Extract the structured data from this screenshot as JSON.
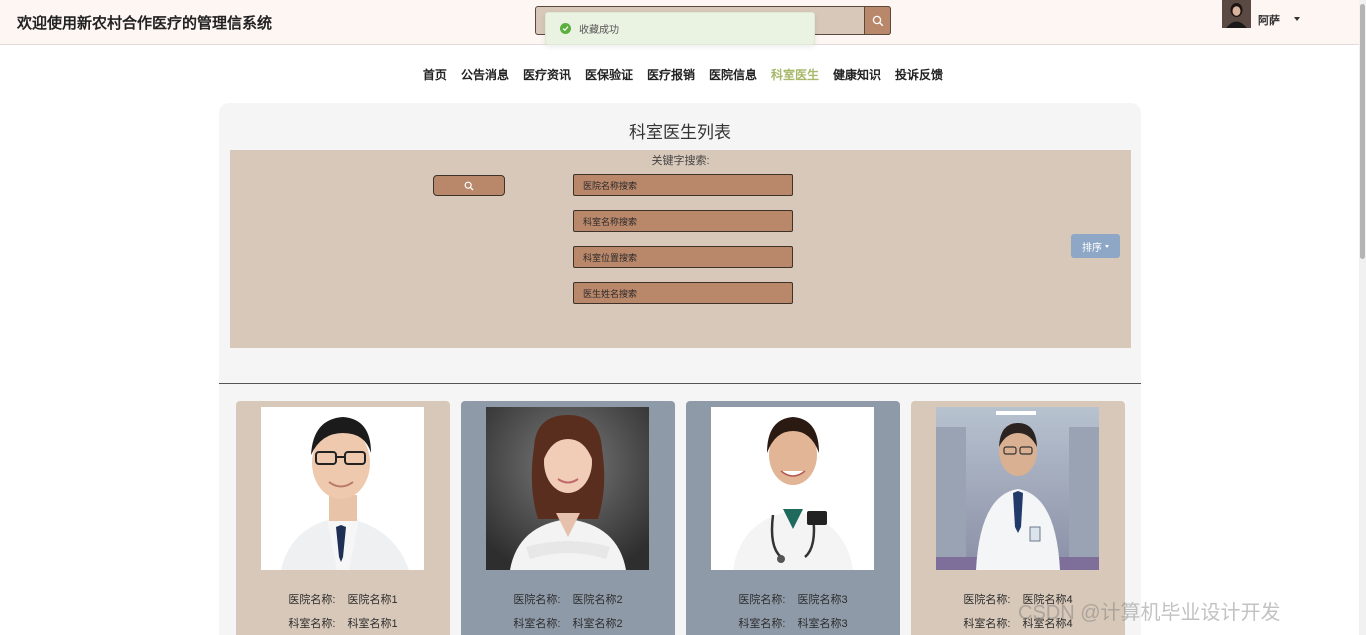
{
  "header": {
    "title": "欢迎使用新农村合作医疗的管理信系统",
    "search_icon": "search-icon",
    "user_name": "阿萨"
  },
  "toast": {
    "message": "收藏成功",
    "icon": "check-circle-icon"
  },
  "nav": {
    "items": [
      "首页",
      "公告消息",
      "医疗资讯",
      "医保验证",
      "医疗报销",
      "医院信息",
      "科室医生",
      "健康知识",
      "投诉反馈"
    ],
    "active": "科室医生"
  },
  "panel": {
    "title": "科室医生列表",
    "keyword_label": "关键字搜索:",
    "search_placeholders": {
      "hospital": "医院名称搜索",
      "department": "科室名称搜索",
      "location": "科室位置搜索",
      "doctor": "医生姓名搜索"
    },
    "sort_label": "排序"
  },
  "doctors": [
    {
      "hospital_label": "医院名称:",
      "hospital": "医院名称1",
      "department_label": "科室名称:",
      "department": "科室名称1"
    },
    {
      "hospital_label": "医院名称:",
      "hospital": "医院名称2",
      "department_label": "科室名称:",
      "department": "科室名称2"
    },
    {
      "hospital_label": "医院名称:",
      "hospital": "医院名称3",
      "department_label": "科室名称:",
      "department": "科室名称3"
    },
    {
      "hospital_label": "医院名称:",
      "hospital": "医院名称4",
      "department_label": "科室名称:",
      "department": "科室名称4"
    }
  ],
  "watermark": "CSDN @计算机毕业设计开发",
  "colors": {
    "accent_active": "#a6b86a",
    "filter_bg": "#d7c8b9",
    "input_bg": "#b9876a",
    "sort_btn": "#8fa7c6",
    "card_alt": "#8f9aa9"
  }
}
